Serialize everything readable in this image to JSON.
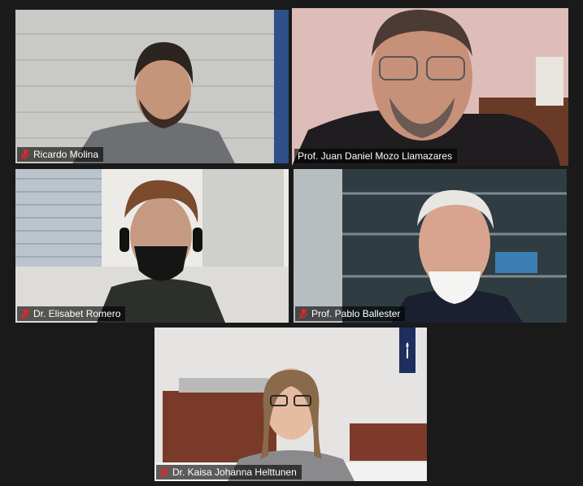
{
  "meeting": {
    "participants": [
      {
        "name": "Ricardo Molina",
        "muted": true
      },
      {
        "name": "Prof. Juan Daniel Mozo Llamazares",
        "muted": false,
        "active_speaker": true
      },
      {
        "name": "Dr. Elisabet Romero",
        "muted": true
      },
      {
        "name": "Prof. Pablo Ballester",
        "muted": true
      },
      {
        "name": "Dr. Kaisa Johanna Helttunen",
        "muted": true
      }
    ]
  },
  "colors": {
    "active_speaker_border": "#c6e64a",
    "muted_icon": "#e02828",
    "background": "#1a1a1a"
  },
  "icons": [
    "mic-muted-icon"
  ]
}
